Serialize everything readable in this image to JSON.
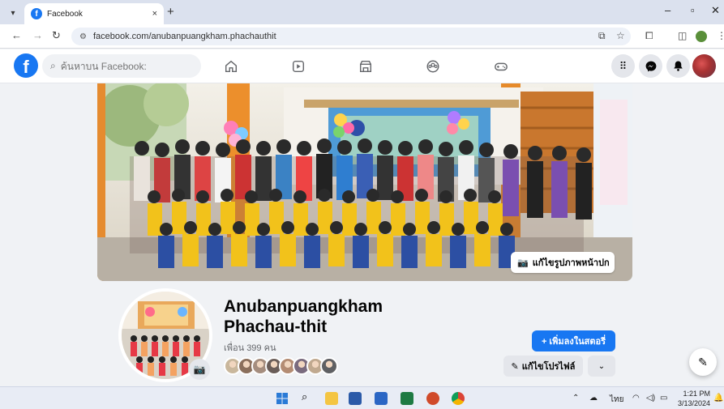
{
  "browser": {
    "tab_title": "Facebook",
    "tab_close": "×",
    "new_tab": "+",
    "url": "facebook.com/anubanpuangkham.phachauthit",
    "window_controls": [
      "–",
      "▫",
      "✕"
    ]
  },
  "fb_header": {
    "logo": "f",
    "search_placeholder": "ค้นหาบน Facebook:",
    "nav_icons": [
      "home-icon",
      "video-icon",
      "marketplace-icon",
      "groups-icon",
      "gaming-icon"
    ],
    "right_icons": [
      "menu-grid-icon",
      "messenger-icon",
      "notifications-icon",
      "account-avatar"
    ]
  },
  "cover": {
    "edit_label": "แก้ไขรูปภาพหน้าปก"
  },
  "profile": {
    "name_line1": "Anubanpuangkham",
    "name_line2": "Phachau-thit",
    "friends": "เพื่อน 399 คน",
    "add_story_label": "+ เพิ่มลงในสตอรี่",
    "edit_profile_label": "แก้ไขโปรไฟล์",
    "more_label": "⌄",
    "friend_avatar_colors": [
      "#c9b79c",
      "#8b6f5c",
      "#a58d7e",
      "#6a5d58",
      "#b48c73",
      "#7a6b7e",
      "#c0a98f",
      "#5f6063"
    ]
  },
  "taskbar": {
    "time": "1:21 PM",
    "date": "3/13/2024",
    "lang": "ไทย",
    "pinned": [
      "windows-start",
      "search",
      "file-explorer",
      "store",
      "word",
      "excel",
      "powerpoint",
      "chrome"
    ]
  }
}
